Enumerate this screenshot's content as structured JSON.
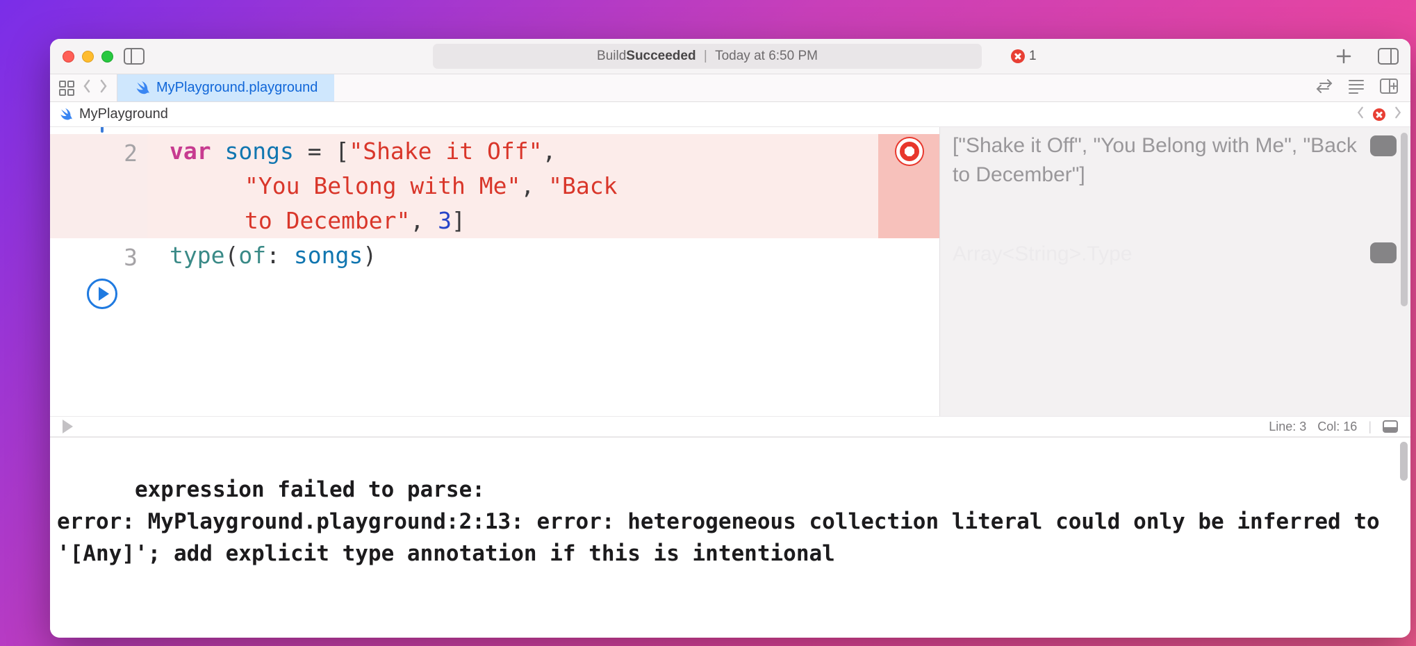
{
  "titlebar": {
    "status_prefix": "Build ",
    "status_strong": "Succeeded",
    "status_suffix": "Today at 6:50 PM",
    "error_count": "1"
  },
  "tab": {
    "filename": "MyPlayground.playground"
  },
  "breadcrumb": {
    "name": "MyPlayground"
  },
  "code": {
    "line_numbers": {
      "l2": "2",
      "l3": "3"
    },
    "l2a_kw": "var",
    "l2a_sp1": " ",
    "l2a_ident": "songs",
    "l2a_sp2": " ",
    "l2a_eq": "=",
    "l2a_sp3": " ",
    "l2a_lb": "[",
    "l2a_s1": "\"Shake it Off\"",
    "l2a_c1": ",",
    "l2b_s2": "\"You Belong with Me\"",
    "l2b_c2": ",",
    "l2b_sp4": " ",
    "l2b_s3": "\"Back to December\"",
    "l2c_s3b": "",
    "l2c_c3": ",",
    "l2c_sp5": " ",
    "l2c_num": "3",
    "l2c_rb": "]",
    "l3_call": "type",
    "l3_lp": "(",
    "l3_lbl": "of",
    "l3_colon": ":",
    "l3_sp": " ",
    "l3_arg": "songs",
    "l3_rp": ")"
  },
  "results": {
    "r1": "[\"Shake it Off\", \"You Belong with Me\", \"Back to December\"]",
    "r2": "Array<String>.Type"
  },
  "status": {
    "line": "Line: 3",
    "col": "Col: 16"
  },
  "console": {
    "text": "expression failed to parse:\nerror: MyPlayground.playground:2:13: error: heterogeneous collection literal could only be inferred to '[Any]'; add explicit type annotation if this is intentional"
  }
}
